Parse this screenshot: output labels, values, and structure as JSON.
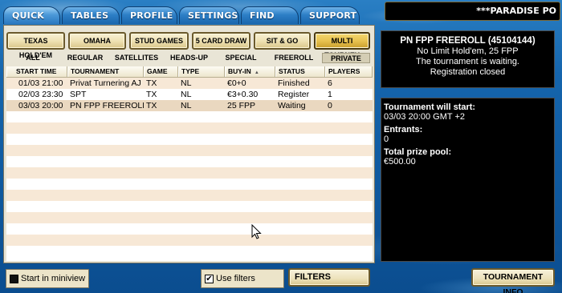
{
  "tabs": [
    "QUICK PLAY",
    "TABLES",
    "PROFILE",
    "SETTINGS",
    "FIND PLAYER",
    "SUPPORT"
  ],
  "site_title": "***PARADISE PO",
  "game_types": [
    "TEXAS HOLD'EM",
    "OMAHA",
    "STUD GAMES",
    "5 CARD DRAW",
    "SIT & GO",
    "MULTI TOURNEY"
  ],
  "categories": [
    "ALL",
    "REGULAR",
    "SATELLITES",
    "HEADS-UP",
    "SPECIAL",
    "FREEROLL",
    "PRIVATE"
  ],
  "table": {
    "headers": [
      "START TIME",
      "TOURNAMENT",
      "GAME",
      "TYPE",
      "BUY-IN",
      "STATUS",
      "PLAYERS"
    ],
    "rows": [
      [
        "01/03 21:00",
        "Privat Turnering AJ",
        "TX",
        "NL",
        "€0+0",
        "Finished",
        "6"
      ],
      [
        "02/03 23:30",
        "SPT",
        "TX",
        "NL",
        "€3+0.30",
        "Register",
        "1"
      ],
      [
        "03/03 20:00",
        "PN FPP FREEROLL",
        "TX",
        "NL",
        "25 FPP",
        "Waiting",
        "0"
      ]
    ]
  },
  "bottom": {
    "miniview_label": "Start in miniview",
    "use_filters_label": "Use filters",
    "use_filters_check": "✔",
    "filters_label": "FILTERS",
    "tournament_info_label": "TOURNAMENT INFO"
  },
  "info": {
    "title": "PN FPP FREEROLL (45104144)",
    "game": "No Limit Hold'em, 25 FPP",
    "status": "The tournament is waiting.",
    "registration": "Registration closed"
  },
  "details": {
    "start_label": "Tournament will start:",
    "start_value": "03/03 20:00 GMT +2",
    "entrants_label": "Entrants:",
    "entrants_value": "0",
    "prize_label": "Total prize pool:",
    "prize_value": "€500.00"
  },
  "colors": {
    "background": "#1565ad",
    "tab": "#2d7fc6",
    "panel": "#e9e5d6",
    "selected_button": "#e8c250",
    "info_panel": "#000000"
  },
  "icons": [
    "sort-arrow-icon",
    "checkbox-icon",
    "mouse-pointer-icon"
  ]
}
